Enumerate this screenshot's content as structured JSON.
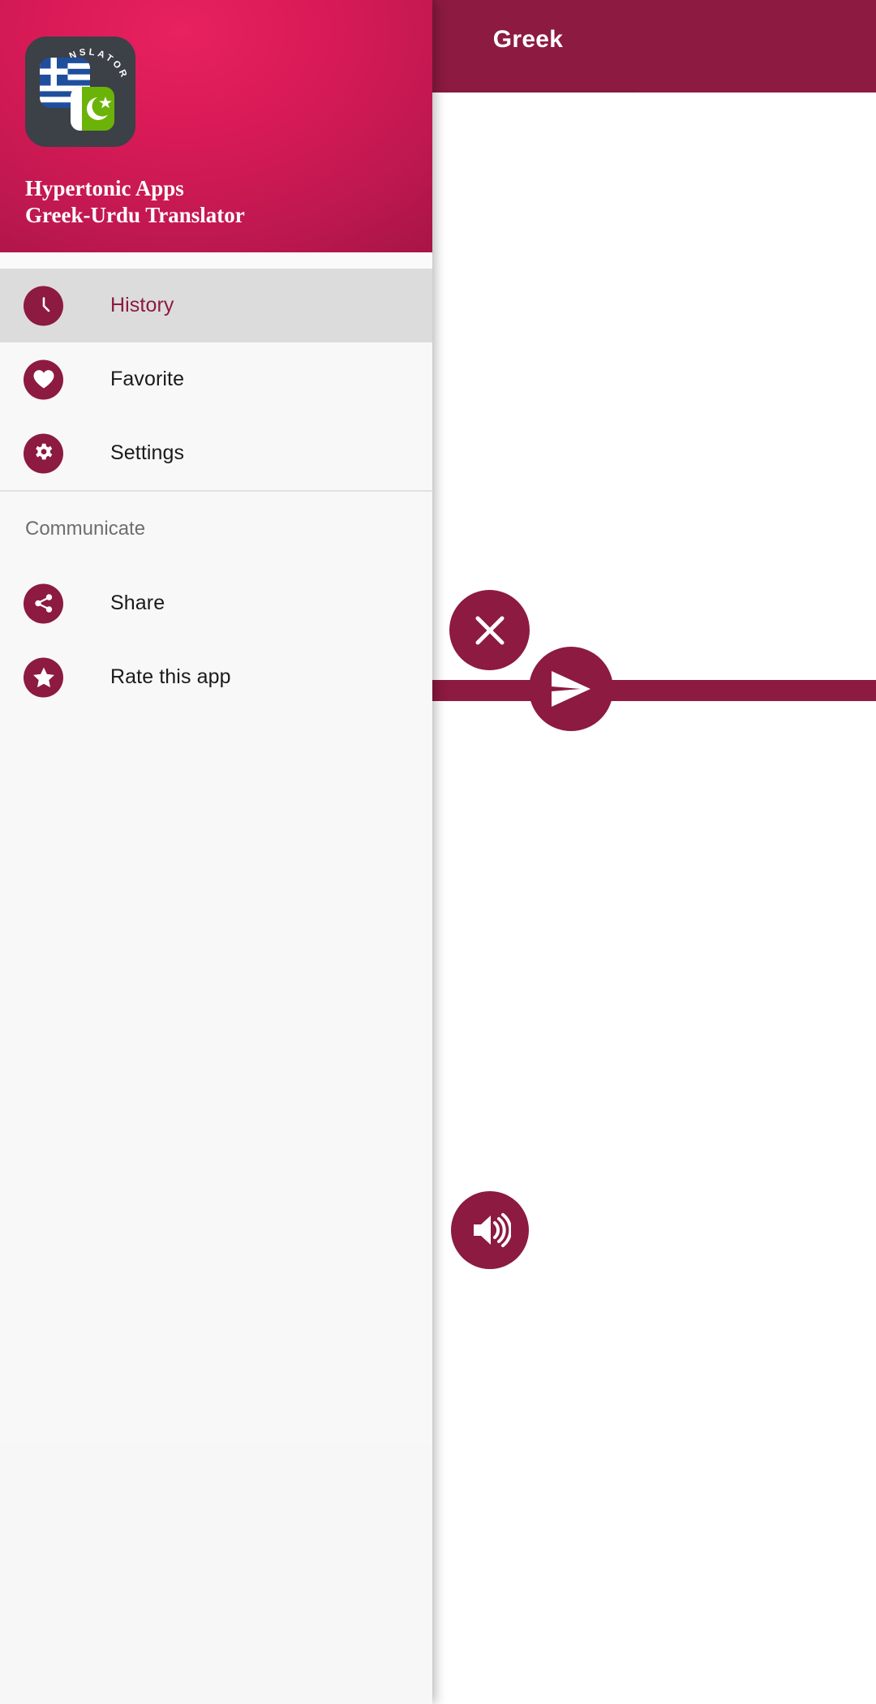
{
  "app": {
    "name": "Greek-Urdu Translator",
    "publisher": "Hypertonic Apps",
    "logo_text": "TRANSLATOR",
    "accent_color": "#8c1a41",
    "header_gradient_from": "#e8215f",
    "header_gradient_to": "#8a1039"
  },
  "appbar": {
    "title": "Greek"
  },
  "drawer": {
    "header": {
      "publisher": "Hypertonic Apps",
      "app_name": "Greek-Urdu Translator",
      "logo_label": "TRANSLATOR",
      "source_flag": "greek-flag",
      "target_flag": "pakistan-flag"
    },
    "items": [
      {
        "label": "History",
        "icon": "clock-icon",
        "selected": true
      },
      {
        "label": "Favorite",
        "icon": "heart-icon",
        "selected": false
      },
      {
        "label": "Settings",
        "icon": "gear-icon",
        "selected": false
      }
    ],
    "section": {
      "title": "Communicate",
      "items": [
        {
          "label": "Share",
          "icon": "share-icon"
        },
        {
          "label": "Rate this app",
          "icon": "star-icon"
        }
      ]
    }
  },
  "main": {
    "buttons": [
      {
        "name": "clear-button",
        "icon": "close-icon"
      },
      {
        "name": "send-button",
        "icon": "send-icon"
      },
      {
        "name": "speak-button",
        "icon": "speaker-icon"
      }
    ]
  }
}
